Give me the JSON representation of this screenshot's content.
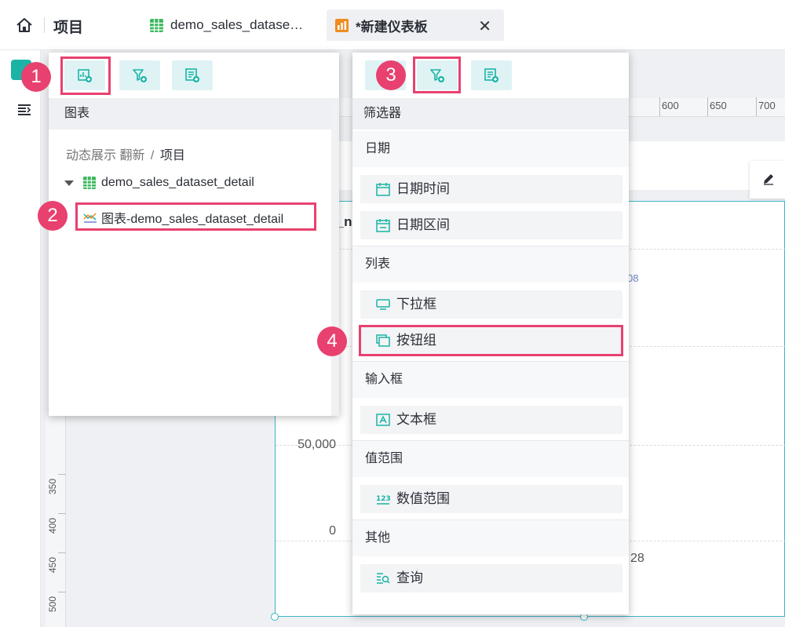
{
  "header": {
    "project_title": "项目",
    "tabs": [
      {
        "label": "demo_sales_datase…",
        "icon": "table-icon"
      },
      {
        "label": "*新建仪表板",
        "icon": "dashboard-icon"
      }
    ]
  },
  "canvas": {
    "ruler_h": [
      "600",
      "650",
      "700"
    ],
    "ruler_v": [
      "350",
      "400",
      "450",
      "500"
    ],
    "y_axis": [
      "50,000",
      "0"
    ],
    "partial_texts": {
      "title_fragment": ":_nc",
      "value_fragment": "08",
      "x_fragment": "28"
    }
  },
  "chart_panel": {
    "section_title": "图表",
    "breadcrumb_prefix": "动态展示 翻新",
    "breadcrumb_sep": "/",
    "breadcrumb_current": "项目",
    "dataset_name": "demo_sales_dataset_detail",
    "chart_item": "图表-demo_sales_dataset_detail"
  },
  "filter_panel": {
    "title": "筛选器",
    "sections": {
      "date": {
        "title": "日期",
        "items": [
          "日期时间",
          "日期区间"
        ]
      },
      "list": {
        "title": "列表",
        "items": [
          "下拉框",
          "按钮组"
        ]
      },
      "input": {
        "title": "输入框",
        "items": [
          "文本框"
        ]
      },
      "range": {
        "title": "值范围",
        "items": [
          "数值范围"
        ]
      },
      "other": {
        "title": "其他",
        "items": [
          "查询"
        ]
      }
    }
  },
  "badges": [
    "1",
    "2",
    "3",
    "4"
  ],
  "colors": {
    "accent": "#1bb3a6",
    "highlight": "#e8416f",
    "toolbar_bg": "#dff3f5"
  }
}
